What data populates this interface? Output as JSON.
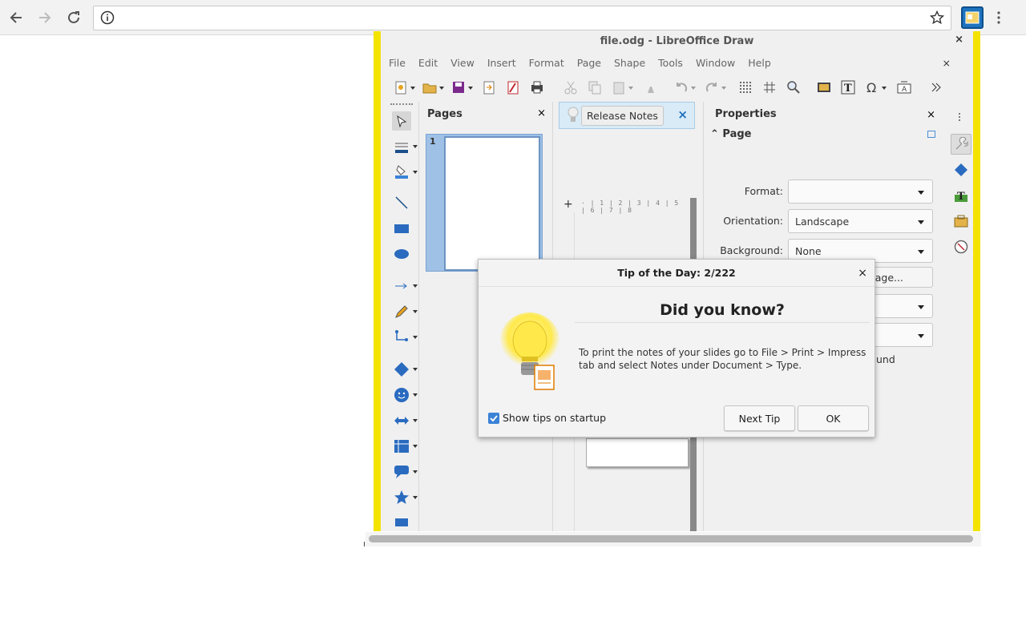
{
  "browser": {
    "back_icon": "arrow-left-icon",
    "forward_icon": "arrow-right-icon",
    "reload_icon": "reload-icon",
    "url": "",
    "info_icon": "info-icon",
    "bookmark_icon": "star-icon",
    "extension_icon": "extension-icon",
    "menu_icon": "vertical-dots-icon"
  },
  "window": {
    "title": "file.odg - LibreOffice Draw",
    "close_symbol": "×"
  },
  "menu": {
    "items": [
      "File",
      "Edit",
      "View",
      "Insert",
      "Format",
      "Page",
      "Shape",
      "Tools",
      "Window",
      "Help"
    ],
    "close_symbol": "×"
  },
  "pages_panel": {
    "title": "Pages",
    "close_symbol": "×",
    "page_number": "1"
  },
  "canvas": {
    "release_notes_label": "Release Notes",
    "close_symbol": "×",
    "ruler_marks": "· | 1 | 2 | 3 | 4 | 5 | 6 | 7 | 8"
  },
  "properties": {
    "title": "Properties",
    "close_symbol": "×",
    "section": "Page",
    "format_label": "Format:",
    "format_value": "",
    "orientation_label": "Orientation:",
    "orientation_value": "Landscape",
    "background_label": "Background:",
    "background_value": "None",
    "insert_image_label": "Insert Image...",
    "partial_text": "und"
  },
  "dialog": {
    "title": "Tip of the Day: 2/222",
    "close_symbol": "×",
    "heading": "Did you know?",
    "tip_text": "To print the notes of your slides go to File > Print > Impress tab and select Notes under Document > Type.",
    "show_tips_label": "Show tips on startup",
    "show_tips_checked": true,
    "next_tip_label": "Next Tip",
    "ok_label": "OK"
  },
  "colors": {
    "accent_yellow": "#f4e300",
    "selection_blue": "#9fc1e6",
    "checkbox_blue": "#3a82d6"
  }
}
